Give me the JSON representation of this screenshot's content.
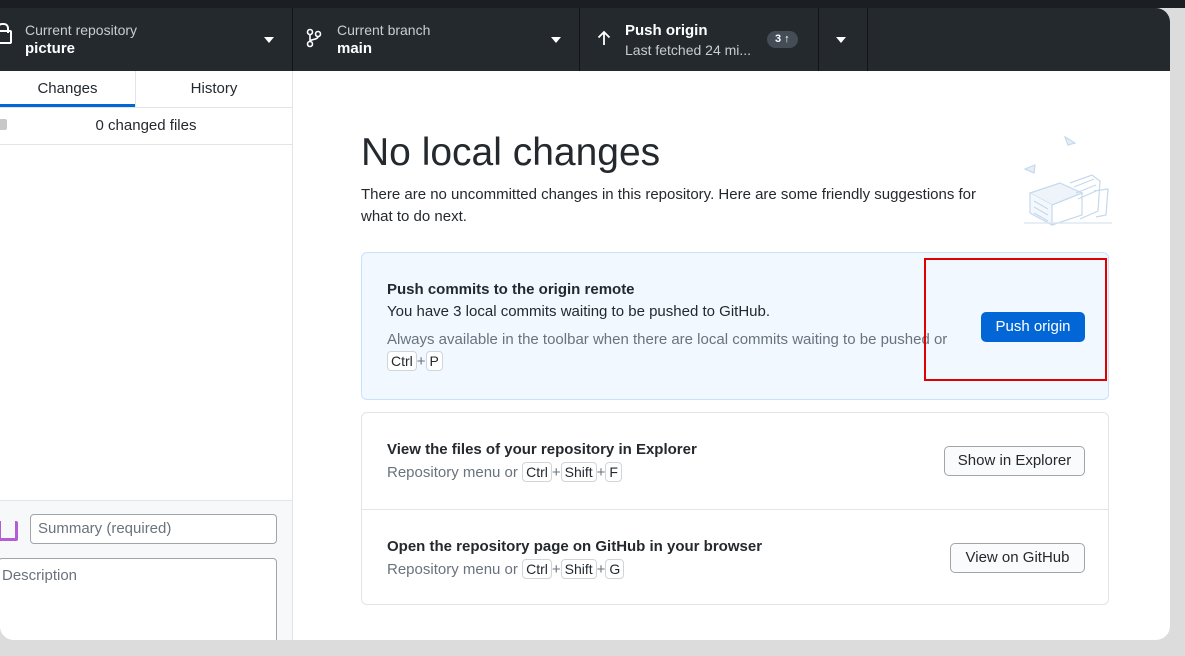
{
  "toolbar": {
    "repo_label": "Current repository",
    "repo_name": "picture",
    "branch_label": "Current branch",
    "branch_name": "main",
    "push_title": "Push origin",
    "push_subtitle": "Last fetched 24 mi...",
    "push_badge": "3 ↑"
  },
  "sidebar": {
    "tabs": [
      {
        "label": "Changes",
        "active": true
      },
      {
        "label": "History",
        "active": false
      }
    ],
    "changed_files": "0 changed files",
    "summary_placeholder": "Summary (required)",
    "description_placeholder": "Description"
  },
  "main": {
    "title": "No local changes",
    "lead": "There are no uncommitted changes in this repository. Here are some friendly suggestions for what to do next.",
    "push_card": {
      "title": "Push commits to the origin remote",
      "text": "You have 3 local commits waiting to be pushed to GitHub.",
      "hint": "Always available in the toolbar when there are local commits waiting to be pushed or",
      "keys": [
        "Ctrl",
        "P"
      ],
      "button": "Push origin"
    },
    "explorer_card": {
      "title": "View the files of your repository in Explorer",
      "hint": "Repository menu or",
      "keys": [
        "Ctrl",
        "Shift",
        "F"
      ],
      "button": "Show in Explorer"
    },
    "github_card": {
      "title": "Open the repository page on GitHub in your browser",
      "hint": "Repository menu or",
      "keys": [
        "Ctrl",
        "Shift",
        "G"
      ],
      "button": "View on GitHub"
    }
  },
  "colors": {
    "accent": "#0366d6",
    "toolbar_bg": "#24292e",
    "highlight": "#e00000"
  }
}
